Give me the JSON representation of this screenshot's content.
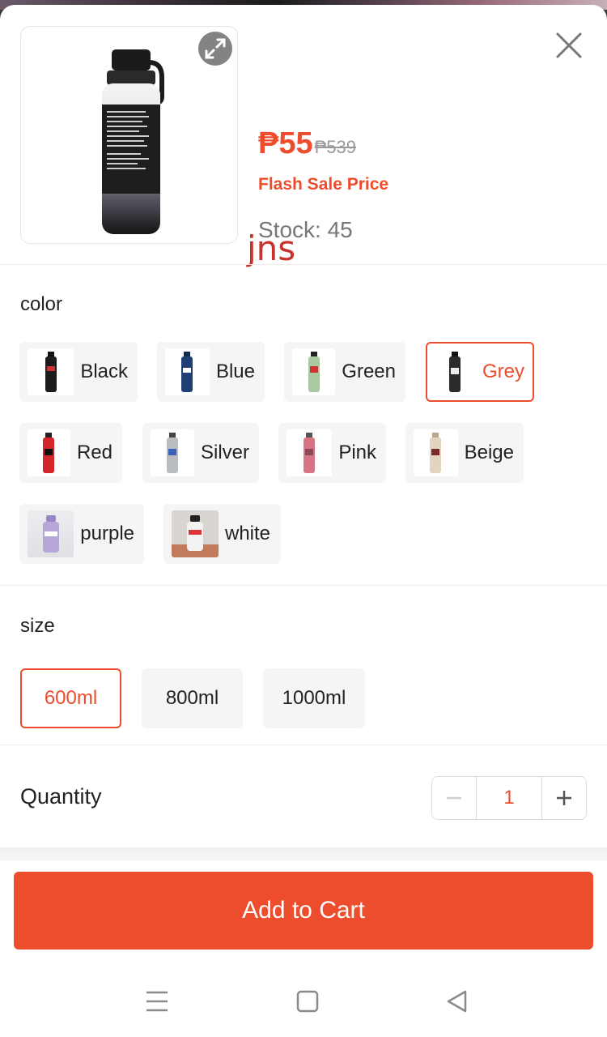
{
  "product": {
    "price_now": "₱55",
    "price_old": "₱539",
    "flash_label": "Flash Sale Price",
    "stock": "Stock: 45",
    "watermark": "jns"
  },
  "color": {
    "title": "color",
    "options": [
      {
        "label": "Black",
        "swatch": "#1c1c1c",
        "selected": false
      },
      {
        "label": "Blue",
        "swatch": "#1f3f73",
        "selected": false
      },
      {
        "label": "Green",
        "swatch": "#a9c9a1",
        "selected": false
      },
      {
        "label": "Grey",
        "swatch": "#2b2b2b",
        "selected": true
      },
      {
        "label": "Red",
        "swatch": "#d3262b",
        "selected": false
      },
      {
        "label": "Silver",
        "swatch": "#b9bdc2",
        "selected": false
      },
      {
        "label": "Pink",
        "swatch": "#d77486",
        "selected": false
      },
      {
        "label": "Beige",
        "swatch": "#e3d4c1",
        "selected": false
      },
      {
        "label": "purple",
        "swatch": "#b9a6d8",
        "selected": false
      },
      {
        "label": "white",
        "swatch": "#f2f2f2",
        "selected": false
      }
    ]
  },
  "size": {
    "title": "size",
    "options": [
      {
        "label": "600ml",
        "selected": true
      },
      {
        "label": "800ml",
        "selected": false
      },
      {
        "label": "1000ml",
        "selected": false
      }
    ]
  },
  "quantity": {
    "label": "Quantity",
    "value": "1",
    "minus": "−",
    "plus": "+"
  },
  "actions": {
    "add_to_cart": "Add to Cart"
  },
  "colors": {
    "accent": "#ee4d2d"
  },
  "icons": {
    "expand": "expand-icon",
    "close": "close-icon",
    "menu": "menu-icon",
    "home": "home-square-icon",
    "back": "back-triangle-icon"
  }
}
